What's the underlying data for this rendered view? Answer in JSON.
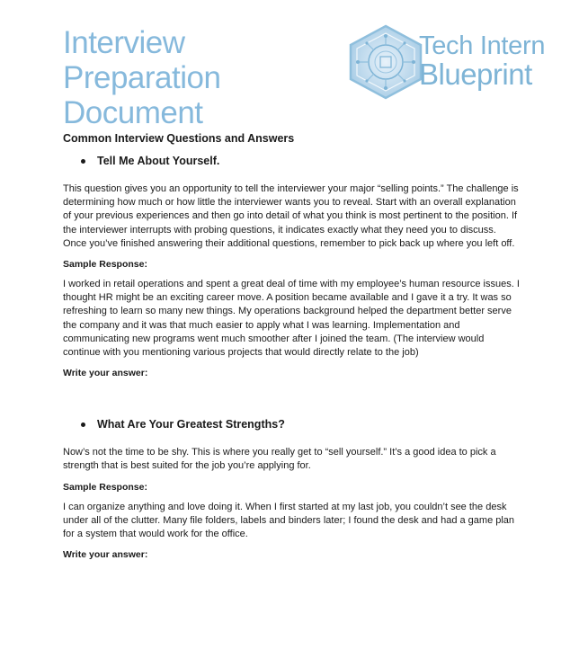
{
  "header": {
    "title_line1": "Interview Preparation",
    "title_line2": "Document",
    "logo": {
      "line1": "Tech Intern",
      "line2": "Blueprint",
      "icon": "hexagon-circuit-icon",
      "color": "#7eb4d6"
    }
  },
  "document": {
    "section_heading": "Common Interview Questions and Answers",
    "questions": [
      {
        "title": "Tell Me About Yourself.",
        "intro": "This question gives you an opportunity to tell the interviewer your major “selling points.” The challenge is determining how much or how little the interviewer wants you to reveal. Start with an overall explanation of your previous experiences and then go into detail of what you think is most pertinent to the position. If the interviewer interrupts with probing questions, it indicates exactly what they need you to discuss. Once you’ve finished answering their additional questions, remember to pick back up where you left off.",
        "sample_label": "Sample Response:",
        "sample": "I worked in retail operations and spent a great deal of time with my employee’s human resource issues. I thought HR might be an exciting career move. A position became available and I gave it a try. It was so refreshing to learn so many new things. My operations background helped the department better serve the company and it was that much easier to apply what I was learning. Implementation and communicating new programs went much smoother after I joined the team. (The interview would continue with you mentioning various projects that would directly relate to the job)",
        "answer_label": "Write your answer:"
      },
      {
        "title": "What Are Your Greatest Strengths?",
        "intro": "Now’s not the time to be shy. This is where you really get to “sell yourself.” It’s a good idea to pick a strength that is best suited for the job you’re applying for.",
        "sample_label": "Sample Response:",
        "sample": "I can organize anything and love doing it. When I first started at my last job, you couldn’t see the desk under all of the clutter. Many file folders, labels and binders later; I found the desk and had a game plan for a system that would work for the office.",
        "answer_label": "Write your answer:"
      }
    ]
  },
  "colors": {
    "title": "#86b9dc",
    "text": "#1a1a1a"
  }
}
